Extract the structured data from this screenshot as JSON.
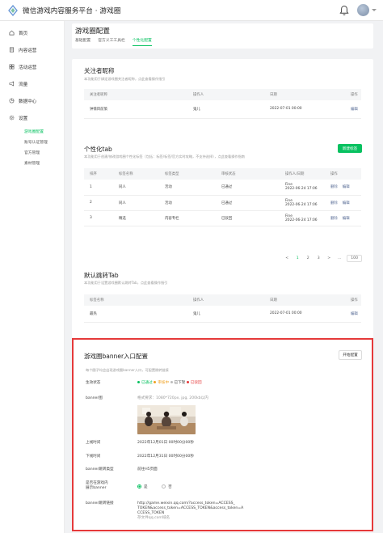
{
  "app": {
    "title": "微信游戏内容服务平台 · 游戏圈"
  },
  "sidebar": {
    "items": [
      {
        "label": "首页",
        "icon": "home-icon"
      },
      {
        "label": "内容运营",
        "icon": "document-icon"
      },
      {
        "label": "活动运营",
        "icon": "grid-icon"
      },
      {
        "label": "流量",
        "icon": "megaphone-icon"
      },
      {
        "label": "数据中心",
        "icon": "chart-icon"
      },
      {
        "label": "设置",
        "icon": "gear-icon"
      }
    ],
    "sub_items": [
      {
        "label": "游戏圈配置",
        "active": true
      },
      {
        "label": "账号认证管理",
        "active": false
      },
      {
        "label": "官方管理",
        "active": false
      },
      {
        "label": "素材管理",
        "active": false
      }
    ]
  },
  "page": {
    "title": "游戏圈配置",
    "tabs": [
      "基础配置",
      "官方义工工具栏",
      "个性化配置"
    ],
    "active_tab": 2
  },
  "followed_nickname": {
    "title": "关注者昵称",
    "desc": "本功能用于绑定游戏圈关注者昵称，点此查看操作指引",
    "columns": [
      "关注者昵称",
      "操作人",
      "日期",
      "操作"
    ],
    "rows": [
      {
        "name": "钟情目前策",
        "operator": "鬼儿",
        "date": "2022-07-01 00:00",
        "action": "编辑"
      }
    ]
  },
  "custom_tab": {
    "title": "个性化tab",
    "desc": "本功能用于创建/修改游戏圈个性化标签（包括：标签/标签/官方实时攻略，不支持选择），点此查看操作指南",
    "new_button": "新建标签",
    "columns": [
      "排序",
      "标签名称",
      "标签类型",
      "审核状态",
      "操作人/日期",
      "操作"
    ],
    "rows": [
      {
        "order": "1",
        "name": "同人",
        "type": "活动",
        "status": "已通过",
        "operator": "Fine",
        "date": "2022-06-24 17:06",
        "actions": [
          "删除",
          "编辑"
        ]
      },
      {
        "order": "2",
        "name": "同人",
        "type": "活动",
        "status": "已通过",
        "operator": "Fine",
        "date": "2022-06-24 17:06",
        "actions": [
          "删除",
          "编辑"
        ]
      },
      {
        "order": "3",
        "name": "精选",
        "type": "内容专栏",
        "status": "已驳回",
        "operator": "Fine",
        "date": "2022-06-24 17:06",
        "actions": [
          "删除",
          "编辑"
        ]
      }
    ],
    "pager": {
      "prev": "<",
      "pages": [
        "1",
        "2",
        "3"
      ],
      "next": ">",
      "ellipsis": "…",
      "last": "100"
    }
  },
  "default_tab": {
    "title": "默认跳转Tab",
    "desc": "本功能用于设置游戏圈默认跳转Tab，点此查看操作指引",
    "columns": [
      "标签名称",
      "操作人",
      "日期",
      "操作"
    ],
    "rows": [
      {
        "name": "最热",
        "operator": "鬼儿",
        "date": "2022-07-01 00:00",
        "action": "编辑"
      }
    ]
  },
  "banner": {
    "title": "游戏圈banner入口配置",
    "desc": "每个圈子均会出现游戏圈banner入口，可配置跳转链接",
    "config_button": "开始配置",
    "fields": {
      "status_label": "生效状态",
      "status_items": [
        {
          "text": "已通过",
          "color": "#07c160"
        },
        {
          "text": "审核中",
          "color": "#f0a020"
        },
        {
          "text": "已下架",
          "color": "#bbbbbb"
        },
        {
          "text": "已驳回",
          "color": "#e5393a"
        }
      ],
      "banner_label": "banner图",
      "banner_hint": "格式要求：1080*720px, jpg, 200kb以内",
      "online_label": "上线时间",
      "online_value": "2022年12月01日 00时00分00秒",
      "offline_label": "下线时间",
      "offline_value": "2022年12月31日 00时00分00秒",
      "jump_type_label": "banner跳转类型",
      "jump_type_value": "前往H5页面",
      "show_label_1": "是否在游戏内",
      "show_label_2": "展示banner",
      "show_yes": "是",
      "show_no": "否",
      "link_label": "banner跳转链接",
      "link_lines": [
        "http://game.weixin.qq.com/?access_token=ACCESS_",
        "TOKEN&access_token=ACCESS_TOKEN&access_token=A",
        "CCESS_TOKEN"
      ],
      "link_note": "存文件qq.com域名"
    }
  }
}
